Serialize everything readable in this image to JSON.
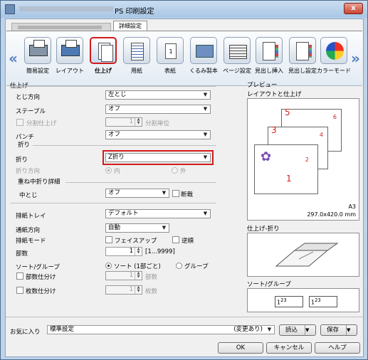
{
  "window": {
    "title": "PS 印刷設定",
    "close": "x"
  },
  "tabs": {
    "active": "詳細設定"
  },
  "toolbar": {
    "prev": "«",
    "next": "»",
    "items": [
      "簡易設定",
      "レイアウト",
      "仕上げ",
      "用紙",
      "表紙",
      "くるみ製本",
      "ページ設定",
      "見出し挿入",
      "見出し設定",
      "カラーモード"
    ]
  },
  "icons": {
    "cover_page": "1"
  },
  "finishing": {
    "section": "仕上げ",
    "binding": {
      "label": "とじ方向",
      "value": "左とじ"
    },
    "staple": {
      "label": "ステープル",
      "value": "オフ"
    },
    "split_finish": {
      "label": "分割仕上げ",
      "value": "1",
      "unit": "分割単位"
    },
    "punch": {
      "label": "パンチ",
      "value": "オフ"
    },
    "fold_section": "折り",
    "fold": {
      "label": "折り",
      "value": "Z折り"
    },
    "fold_dir": {
      "label": "折り方向",
      "in": "内",
      "out": "外"
    },
    "saddle_section": "重ね中折り詳細",
    "saddle": {
      "label": "中とじ",
      "value": "オフ",
      "checkbox": "断裁"
    }
  },
  "output": {
    "tray": {
      "label": "排紙トレイ",
      "value": "デフォルト"
    },
    "paper_dir": {
      "label": "通紙方向",
      "value": "自動"
    },
    "mode": {
      "label": "排紙モード",
      "faceup": "フェイスアップ",
      "reverse": "逆順"
    },
    "copies": {
      "label": "部数",
      "value": "1",
      "range": "[1...9999]"
    },
    "sort": {
      "label": "ソート/グループ",
      "sort": "ソート (1部ごと)",
      "group": "グループ"
    },
    "offset_copies": {
      "label": "部数仕分け",
      "value": "1",
      "unit": "部数"
    },
    "offset_sheets": {
      "label": "枚数仕分け",
      "value": "1",
      "unit": "枚数"
    }
  },
  "preview": {
    "title": "プレビュー",
    "subtitle": "レイアウトと仕上げ",
    "page_numbers": [
      "5",
      "6",
      "3",
      "4",
      "1",
      "2"
    ],
    "paper": "A3",
    "size": "297.0x420.0 mm",
    "fold_title": "仕上げ-折り",
    "sort_title": "ソート/グループ",
    "sort_digits": [
      "1",
      "2",
      "3",
      "1",
      "2",
      "3"
    ]
  },
  "footer": {
    "favorites_label": "お気に入り",
    "favorites_value": "標準設定",
    "changed": "(変更あり)",
    "load": "読込",
    "save": "保存",
    "ok": "OK",
    "cancel": "キャンセル",
    "help": "ヘルプ"
  },
  "colors": {
    "highlight": "#d11a1a",
    "band": "#e3ebf3",
    "accent": "#4f7ec0"
  }
}
